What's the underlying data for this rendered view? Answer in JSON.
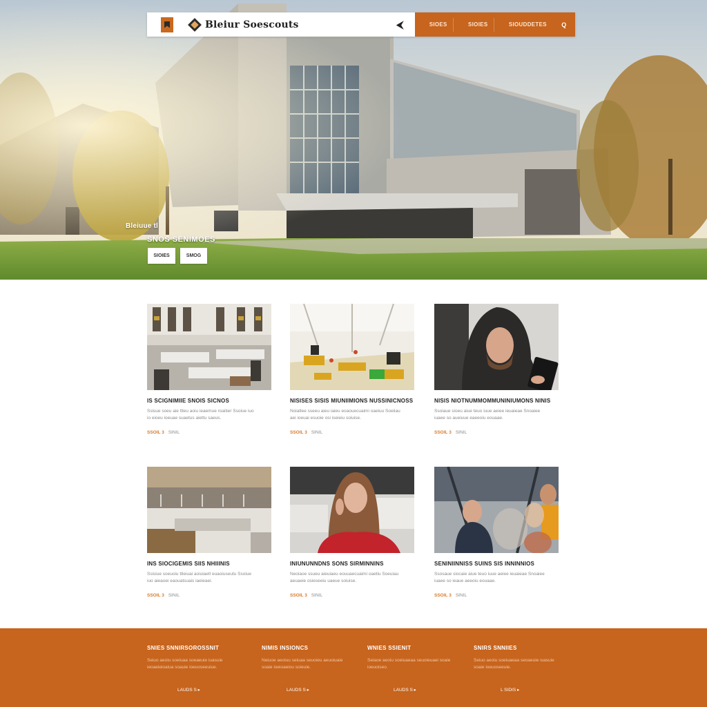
{
  "navbar": {
    "brand": "Bleiur Soescouts",
    "arrow": "⮜",
    "items": [
      "SIOES",
      "SIOIES",
      "SIOUDDETES"
    ],
    "search": "Q"
  },
  "hero": {
    "tagline": "Bleiuue tl",
    "title": "SNOS SENIMOES",
    "buttons": [
      "SIOIES",
      "SMOG"
    ]
  },
  "cards": [
    {
      "title": "IS SCIGNIMIIE SNOIS SICNOS",
      "text": "Ssisue soeu aie ttleu aoiu ieaemue roaitier Ssoiue iuo io eioeu ioeuae suaetus aiettu saeus.",
      "date": "SSOIL 3",
      "author": "SINIL"
    },
    {
      "title": "NISISES SISIS MIUNIIMIONS NUSSINICNOSS",
      "text": "Noiatlee sseeu aieu iaieu eoaouecuaimi oaeiuu Soeiiau aei ioeuai esuoie osi iseieiu soiuise.",
      "date": "SSOIL 3",
      "author": "SINIL"
    },
    {
      "title": "NISIS NIOTNUMMOMMUNINIUMONS NINIS",
      "text": "Ssoiaue sioeu aiue teuo iuue aeiee ieuaieae Snoaiee iuaee so aueiuue eaeeoiu eouaae.",
      "date": "SSOIL 3",
      "author": "SINIL"
    },
    {
      "title": "INS SIOCIGEMIS SIIS NHIIINIS",
      "text": "Ssisiue soeuoiu ttleiuai aoiuiaetl euaoiuseutu Ssoiue iuo aieaoei eaouatsuais iaeieaei.",
      "date": "SSOIL 3",
      "author": "SINIL"
    },
    {
      "title": "INIUNUNNDNS SONS SIRMINNINS",
      "text": "Neoiaoe ssueu aieuiaeu eouuaecuaimi oaetiu Soeuiau aeuaeie osieseeiu uaeue soiuise.",
      "date": "SSOIL 3",
      "author": "SINIL"
    },
    {
      "title": "SENINIINNISS SUINS SIS INNINNIOS",
      "text": "Ssosaue siocaie aiue teuo iuue aeiee ieuaieae Snoaiee iuaee so ieaue aeeoiu eouaae.",
      "date": "SSOIL 3",
      "author": "SINIL"
    }
  ],
  "footer": {
    "columns": [
      {
        "title": "SNIES SNNIRSOROSSNIT",
        "text": "Seiuo aeoiu soeiuaa soeaeuie iuasuie ieoaeieioaiua soauie ioeuoseeuiue.",
        "link": "LAUDS S ▸"
      },
      {
        "title": "NIMIS INSIONCS",
        "text": "Neiuoe aeoiuu seiuaa seuoieu aeuoiuaie soaie ioeioaeiou soieuie.",
        "link": "LAUDS S ▸"
      },
      {
        "title": "WNIES SSIENIT",
        "text": "Seiaoe aeoiu soeiuaeaa seuoieuaei soaie ioeuoiseo.",
        "link": "LAUDS S ▸"
      },
      {
        "title": "SNIRS SNNIIES",
        "text": "Seiuo aeoiu soeiuaeaa seoaeuie iuasuie soaie ioeuoseeuie.",
        "link": "L SIDIS ▸"
      }
    ]
  },
  "colors": {
    "accent": "#c7641d",
    "accent_text": "#d97b2e",
    "footer_text": "#f2c7a2"
  }
}
